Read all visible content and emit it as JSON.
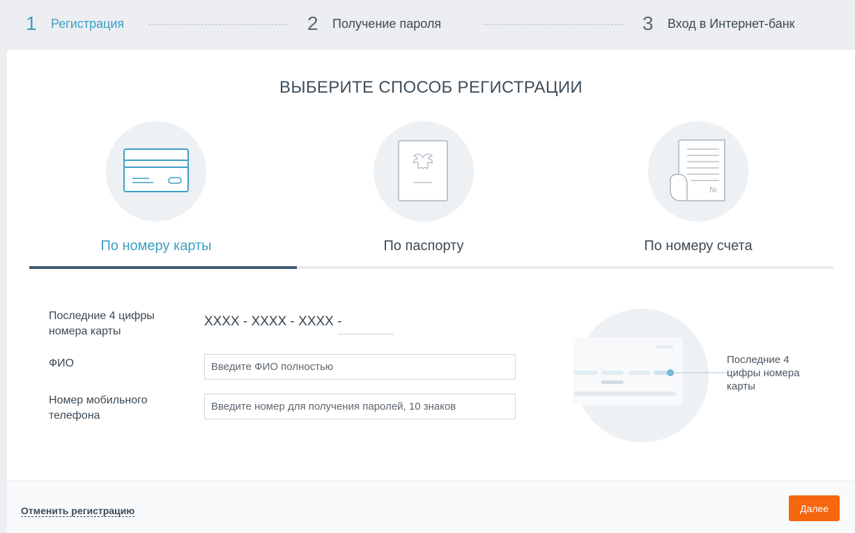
{
  "stepper": {
    "steps": [
      {
        "number": "1",
        "label": "Регистрация",
        "active": true
      },
      {
        "number": "2",
        "label": "Получение пароля",
        "active": false
      },
      {
        "number": "3",
        "label": "Вход в Интернет-банк",
        "active": false
      }
    ]
  },
  "page": {
    "title": "ВЫБЕРИТЕ СПОСОБ РЕГИСТРАЦИИ"
  },
  "methods": [
    {
      "label": "По номеру карты",
      "icon": "bank-card-icon",
      "active": true
    },
    {
      "label": "По паспорту",
      "icon": "passport-icon",
      "active": false
    },
    {
      "label": "По номеру счета",
      "icon": "account-document-icon",
      "active": false
    }
  ],
  "form": {
    "card_digits_label": "Последние 4 цифры номера карты",
    "card_mask": "XXXX - XXXX - XXXX -",
    "card_digits_value": "",
    "fio_label": "ФИО",
    "fio_placeholder": "Введите ФИО полностью",
    "fio_value": "",
    "phone_label": "Номер мобильного телефона",
    "phone_placeholder": "Введите номер для получения паролей, 10 знаков",
    "phone_value": ""
  },
  "hint": {
    "caption": "Последние 4 цифры номера карты"
  },
  "footer": {
    "cancel_label": "Отменить регистрацию",
    "next_label": "Далее"
  },
  "colors": {
    "accent": "#3b9fc5",
    "tab_indicator": "#3d5a71",
    "primary_button": "#f5660e"
  }
}
